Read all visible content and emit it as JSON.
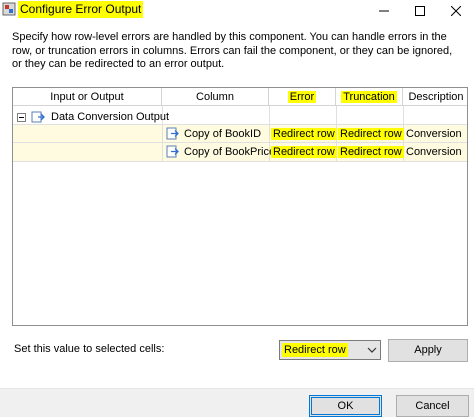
{
  "window": {
    "title": "Configure Error Output",
    "minimize_icon": "minimize-icon",
    "maximize_icon": "maximize-icon",
    "close_icon": "close-icon"
  },
  "description": "Specify how row-level errors are handled by this component. You can handle errors in the row, or truncation errors in columns. Errors can fail the component, or they can be ignored, or they can be redirected to an error output.",
  "grid": {
    "columns": [
      "Input or Output",
      "Column",
      "Error",
      "Truncation",
      "Description"
    ],
    "output_row": {
      "name": "Data Conversion Output",
      "expander": "collapse-minus-icon",
      "icon": "output-icon"
    },
    "rows": [
      {
        "column": "Copy of BookID",
        "error": "Redirect row",
        "truncation": "Redirect row",
        "description": "Conversion",
        "icon": "column-arrow-icon"
      },
      {
        "column": "Copy of BookPrice",
        "error": "Redirect row",
        "truncation": "Redirect row",
        "description": "Conversion",
        "icon": "column-arrow-icon"
      }
    ]
  },
  "bottom": {
    "set_value_label": "Set this value to selected cells:",
    "selected_value": "Redirect row",
    "apply_label": "Apply"
  },
  "footer": {
    "ok_label": "OK",
    "cancel_label": "Cancel"
  },
  "colors": {
    "highlight": "#ffff00",
    "selection_accent": "#0078d7"
  }
}
